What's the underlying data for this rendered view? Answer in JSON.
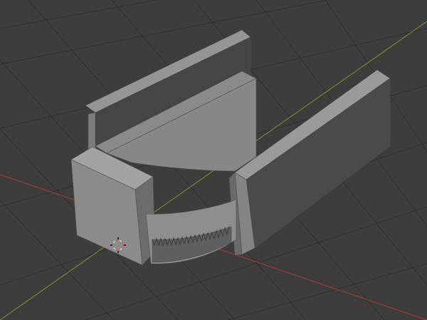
{
  "viewport": {
    "type": "3d-viewport",
    "background": "#3d3d3d",
    "grid_color": "#2f2f2f",
    "x_axis_color": "#9a3b3b",
    "y_axis_color": "#6b8a2c",
    "object_color": "#8f8f8f",
    "object_shadow_color": "#5e5e5e",
    "object_dark_color": "#444444",
    "origin_icon": "3d-cursor-icon"
  }
}
